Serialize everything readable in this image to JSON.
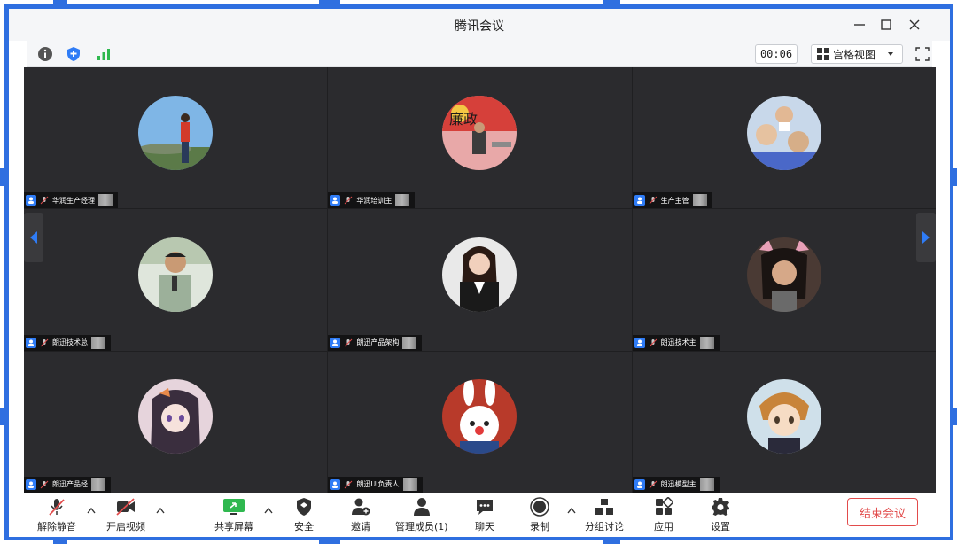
{
  "window": {
    "title": "腾讯会议"
  },
  "toolbar": {
    "timer": "00:06",
    "view_label": "宫格视图"
  },
  "participants": [
    {
      "name": "华润生产经理"
    },
    {
      "name": "华润培训主"
    },
    {
      "name": "生产主管"
    },
    {
      "name": "朗迅技术总"
    },
    {
      "name": "朗迅产品架构"
    },
    {
      "name": "朗迅技术主"
    },
    {
      "name": "朗迅产品经"
    },
    {
      "name": "朗迅UI负责人"
    },
    {
      "name": "朗迅模型主"
    }
  ],
  "bottom": {
    "unmute": "解除静音",
    "start_video": "开启视频",
    "share_screen": "共享屏幕",
    "security": "安全",
    "invite": "邀请",
    "manage_members": "管理成员(1)",
    "chat": "聊天",
    "record": "录制",
    "breakout": "分组讨论",
    "apps": "应用",
    "settings": "设置",
    "end_meeting": "结束会议"
  },
  "colors": {
    "accent": "#2f7cf6",
    "danger": "#e24b4b",
    "grid_bg": "#2b2b2e",
    "signal": "#2fb84f"
  }
}
